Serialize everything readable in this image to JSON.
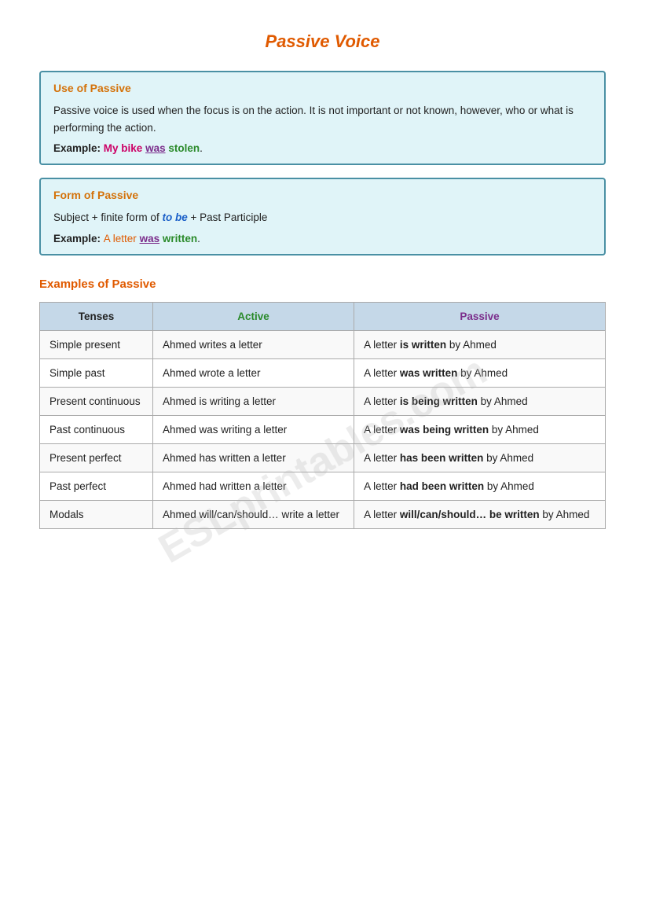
{
  "title": "Passive Voice",
  "watermark": "ESLprintables.com",
  "use_of_passive": {
    "title": "Use of Passive",
    "body": "Passive voice is used when the focus is on the action. It is not important or not known, however, who or what is performing the action.",
    "example_label": "Example:",
    "example_parts": [
      {
        "text": "My bike ",
        "style": "normal"
      },
      {
        "text": "was",
        "style": "purple"
      },
      {
        "text": " stolen",
        "style": "green"
      },
      {
        "text": ".",
        "style": "normal"
      }
    ],
    "example_display": "My bike was stolen."
  },
  "form_of_passive": {
    "title": "Form of Passive",
    "formula": "Subject + finite form of to be + Past Participle",
    "example_label": "Example:",
    "example_display": "A letter was written."
  },
  "examples_title": "Examples of Passive",
  "table": {
    "headers": [
      "Tenses",
      "Active",
      "Passive"
    ],
    "rows": [
      {
        "tense": "Simple present",
        "active": "Ahmed writes a letter",
        "passive_before": "A letter ",
        "passive_verb": "is written",
        "passive_after": " by Ahmed"
      },
      {
        "tense": "Simple past",
        "active": "Ahmed wrote a letter",
        "passive_before": "A letter ",
        "passive_verb": "was written",
        "passive_after": " by Ahmed"
      },
      {
        "tense": "Present continuous",
        "active": "Ahmed is writing a letter",
        "passive_before": "A letter ",
        "passive_verb": "is being written",
        "passive_after": " by Ahmed"
      },
      {
        "tense": "Past continuous",
        "active": "Ahmed was writing a letter",
        "passive_before": "A letter ",
        "passive_verb": "was being written",
        "passive_after": " by Ahmed"
      },
      {
        "tense": "Present perfect",
        "active": "Ahmed has written a letter",
        "passive_before": "A letter ",
        "passive_verb": "has been written",
        "passive_after": " by Ahmed"
      },
      {
        "tense": "Past perfect",
        "active": "Ahmed had written a letter",
        "passive_before": "A letter ",
        "passive_verb": "had been written",
        "passive_after": " by Ahmed"
      },
      {
        "tense": "Modals",
        "active": "Ahmed will/can/should… write a letter",
        "passive_before": "A letter ",
        "passive_verb": "will/can/should… be written",
        "passive_after": " by Ahmed"
      }
    ]
  }
}
